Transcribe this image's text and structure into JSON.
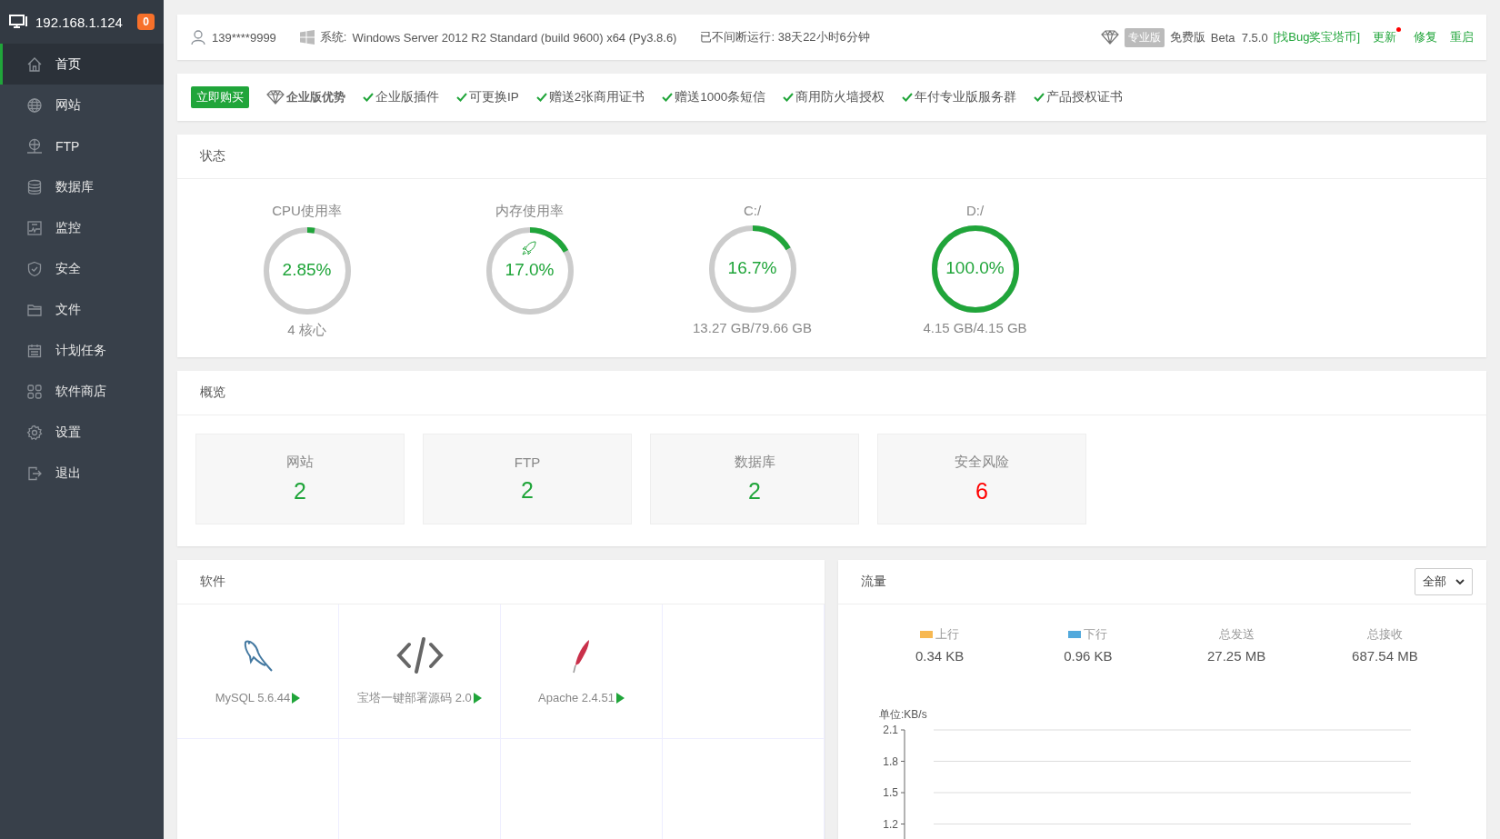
{
  "sidebar": {
    "host": "192.168.1.124",
    "badge": "0",
    "items": [
      {
        "label": "首页",
        "selected": true
      },
      {
        "label": "网站",
        "selected": false
      },
      {
        "label": "FTP",
        "selected": false
      },
      {
        "label": "数据库",
        "selected": false
      },
      {
        "label": "监控",
        "selected": false
      },
      {
        "label": "安全",
        "selected": false
      },
      {
        "label": "文件",
        "selected": false
      },
      {
        "label": "计划任务",
        "selected": false
      },
      {
        "label": "软件商店",
        "selected": false
      },
      {
        "label": "设置",
        "selected": false
      },
      {
        "label": "退出",
        "selected": false
      }
    ]
  },
  "info_bar": {
    "user": "139****9999",
    "system_label": "系统:",
    "system": "Windows Server 2012 R2 Standard (build 9600) x64 (Py3.8.6)",
    "uptime": "已不间断运行: 38天22小时6分钟",
    "pro_badge": "专业版",
    "edition": "免费版",
    "version": "Beta  7.5.0",
    "bug_link": "[找Bug奖宝塔币]",
    "actions": [
      {
        "label": "更新",
        "notify": true
      },
      {
        "label": "修复",
        "notify": false
      },
      {
        "label": "重启",
        "notify": false
      }
    ]
  },
  "promo": {
    "buy_button": "立即购买",
    "title": "企业版优势",
    "features": [
      "企业版插件",
      "可更换IP",
      "赠送2张商用证书",
      "赠送1000条短信",
      "商用防火墙授权",
      "年付专业版服务群",
      "产品授权证书"
    ]
  },
  "status": {
    "title": "状态",
    "gauges": [
      {
        "label": "CPU使用率",
        "value": "2.85%",
        "level": 0.0285,
        "detail": "4 核心"
      },
      {
        "label": "内存使用率",
        "value": "17.0%",
        "level": 0.17,
        "boost_icon": true
      },
      {
        "label": "C:/",
        "value": "16.7%",
        "level": 0.167,
        "detail": "13.27 GB/79.66 GB"
      },
      {
        "label": "D:/",
        "value": "100.0%",
        "level": 1.0,
        "detail": "4.15 GB/4.15 GB"
      }
    ]
  },
  "overview": {
    "title": "概览",
    "cards": [
      {
        "label": "网站",
        "value": "2",
        "color": "#20a53a"
      },
      {
        "label": "FTP",
        "value": "2",
        "color": "#20a53a"
      },
      {
        "label": "数据库",
        "value": "2",
        "color": "#20a53a"
      },
      {
        "label": "安全风险",
        "value": "6",
        "color": "#ff0000"
      }
    ]
  },
  "software": {
    "title": "软件",
    "items": [
      {
        "kind": "mysql",
        "label": "MySQL 5.6.44"
      },
      {
        "kind": "code",
        "label": "宝塔一键部署源码 2.0"
      },
      {
        "kind": "apache",
        "label": "Apache 2.4.51"
      }
    ]
  },
  "traffic": {
    "title": "流量",
    "filter": "全部",
    "stats": [
      {
        "label": "上行",
        "value": "0.34 KB",
        "color": "#f7b851"
      },
      {
        "label": "下行",
        "value": "0.96 KB",
        "color": "#52a9dc"
      },
      {
        "label": "总发送",
        "value": "27.25 MB"
      },
      {
        "label": "总接收",
        "value": "687.54 MB"
      }
    ],
    "chart": {
      "unit": "单位:KB/s",
      "y_labels": [
        "2.1",
        "1.8",
        "1.5",
        "1.2"
      ]
    }
  }
}
